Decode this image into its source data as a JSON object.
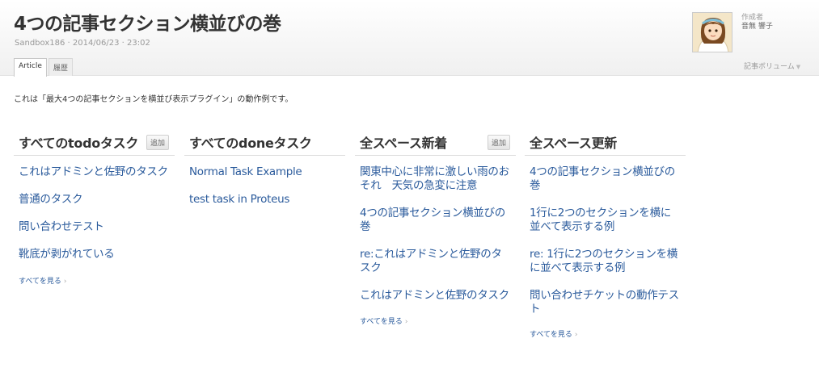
{
  "header": {
    "title": "4つの記事セクション横並びの巻",
    "meta": "Sandbox186 · 2014/06/23 · 23:02",
    "tabs": [
      {
        "label": "Article"
      },
      {
        "label": "履歴"
      }
    ]
  },
  "author": {
    "role": "作成者",
    "name": "音無 響子",
    "avatar_icon": "user-avatar-icon"
  },
  "volume_menu": {
    "label": "記事ボリューム"
  },
  "intro": "これは「最大4つの記事セクションを横並び表示プラグイン」の動作例です。",
  "sections": [
    {
      "title": "すべてのtodoタスク",
      "add_label": "追加",
      "items": [
        {
          "label": "これはアドミンと佐野のタスク"
        },
        {
          "label": "普通のタスク"
        },
        {
          "label": "問い合わせテスト"
        },
        {
          "label": "靴底が剥がれている"
        }
      ],
      "see_all": "すべてを見る"
    },
    {
      "title": "すべてのdoneタスク",
      "items": [
        {
          "label": "Normal Task Example"
        },
        {
          "label": "test task in Proteus"
        }
      ]
    },
    {
      "title": "全スペース新着",
      "add_label": "追加",
      "items": [
        {
          "label": "関東中心に非常に激しい雨のおそれ　天気の急変に注意"
        },
        {
          "label": "4つの記事セクション横並びの巻"
        },
        {
          "label": "re:これはアドミンと佐野のタスク"
        },
        {
          "label": "これはアドミンと佐野のタスク"
        }
      ],
      "see_all": "すべてを見る"
    },
    {
      "title": "全スペース更新",
      "items": [
        {
          "label": "4つの記事セクション横並びの巻"
        },
        {
          "label": "1行に2つのセクションを横に並べて表示する例"
        },
        {
          "label": "re: 1行に2つのセクションを横に並べて表示する例"
        },
        {
          "label": "問い合わせチケットの動作テスト"
        }
      ],
      "see_all": "すべてを見る"
    }
  ],
  "colors": {
    "link": "#2b5b9c",
    "title": "#333333",
    "muted": "#999999"
  }
}
